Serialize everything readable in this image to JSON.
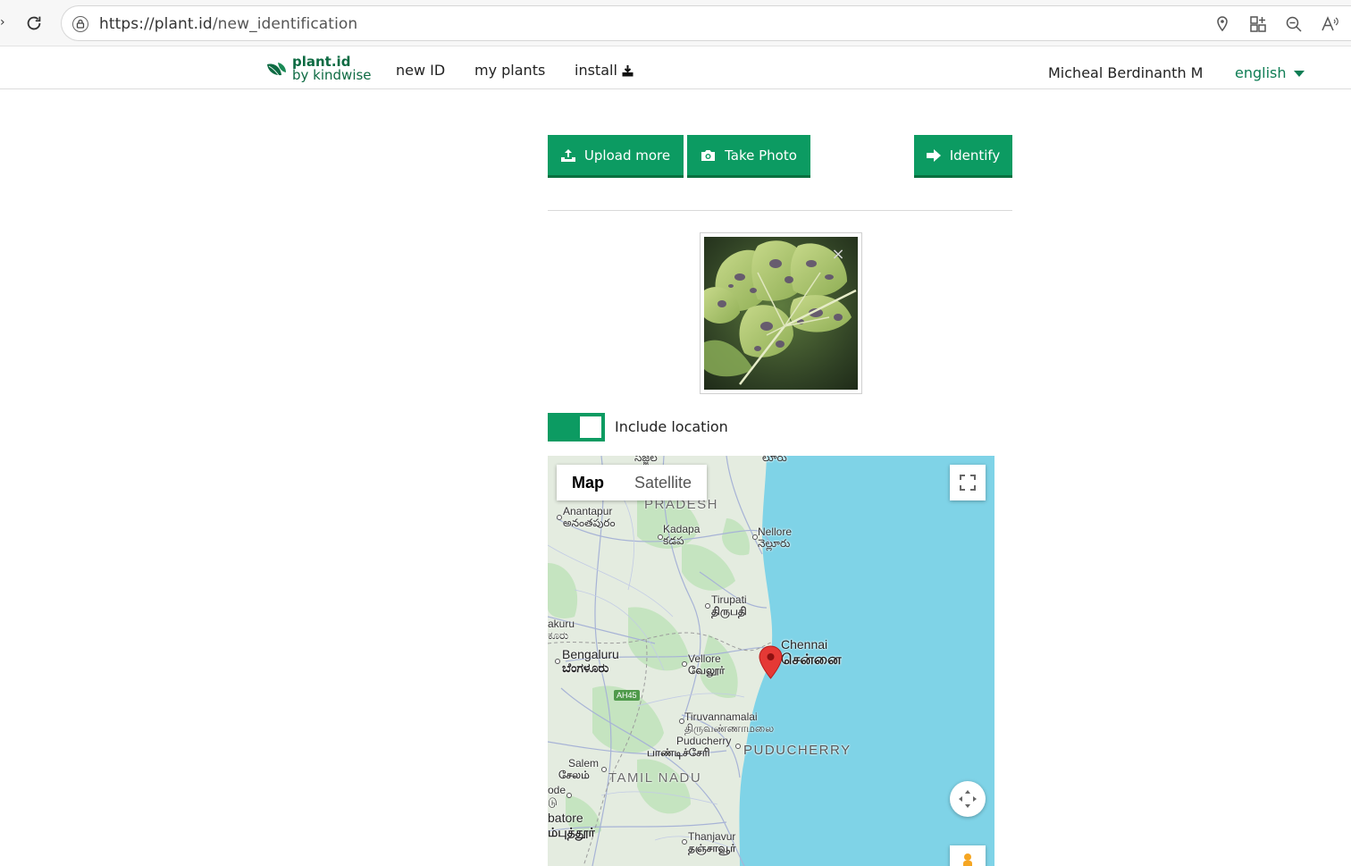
{
  "browser": {
    "url_host": "https://plant.id",
    "url_path": "/new_identification"
  },
  "header": {
    "logo_line1": "plant.id",
    "logo_line2": "by kindwise",
    "nav": {
      "new_id": "new ID",
      "my_plants": "my plants",
      "install": "install"
    },
    "user_name": "Micheal Berdinanth M",
    "language": "english"
  },
  "actions": {
    "upload_more": "Upload more",
    "take_photo": "Take Photo",
    "identify": "Identify"
  },
  "location": {
    "toggle_label": "Include location",
    "toggle_on": true
  },
  "map": {
    "type_options": [
      "Map",
      "Satellite"
    ],
    "selected_type": "Map",
    "labels": {
      "pradesh": "PRADESH",
      "anantapur": "Anantapur",
      "anantapur_te": "అనంతపురం",
      "kadapa": "Kadapa",
      "kadapa_te": "కడప",
      "nellore": "Nellore",
      "nellore_te": "నెల్లూరు",
      "tirupati": "Tirupati",
      "tirupati_ta": "திருபதி",
      "akuru": "akuru",
      "akuru_kn": "ಕೂರು",
      "bengaluru": "Bengaluru",
      "bengaluru_kn": "ಬೆಂಗಳೂರು",
      "vellore": "Vellore",
      "vellore_ta": "வேலூர்",
      "chennai": "Chennai",
      "chennai_ta": "சென்னை",
      "ah45": "AH45",
      "tiruvannamalai": "Tiruvannamalai",
      "tiruvannamalai_ta": "திருவண்ணாமலை",
      "puducherry": "Puducherry",
      "puducherry_ta": "பாண்டிச்சேரி",
      "puducherry_state": "PUDUCHERRY",
      "salem": "Salem",
      "salem_ta": "சேலம்",
      "tamil_nadu": "TAMIL NADU",
      "erode": "ode",
      "erode_ta": "டு",
      "coimbatore": "batore",
      "coimbatore_ta": "ம்புத்தூர்",
      "thanjavur": "Thanjavur",
      "thanjavur_ta": "தஞ்சாவூர்",
      "top_cut1": "సజ్జల",
      "top_cut2": "లూరు"
    }
  },
  "colors": {
    "brand_green": "#0c9b62",
    "logo_green": "#0e6b43",
    "sea": "#7fd3e7",
    "marker": "#e53935"
  }
}
